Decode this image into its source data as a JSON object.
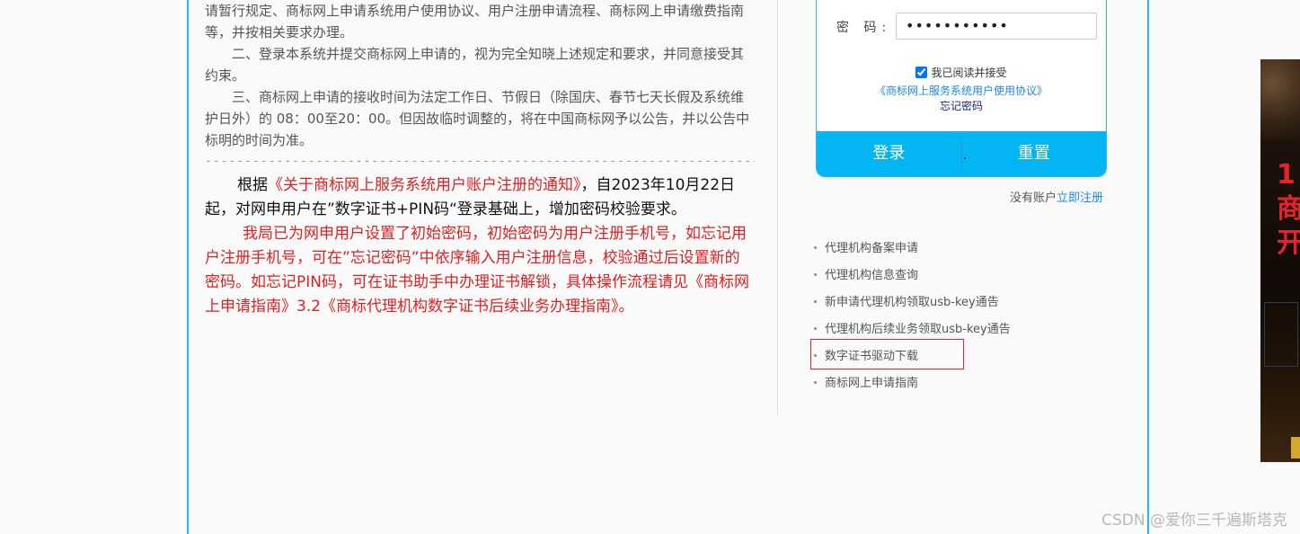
{
  "notice": {
    "p1": "请暂行规定、商标网上申请系统用户使用协议、用户注册申请流程、商标网上申请缴费指南等，并按相关要求办理。",
    "p2": "二、登录本系统并提交商标网上申请的，视为完全知晓上述规定和要求，并同意接受其约束。",
    "p3": "三、商标网上申请的接收时间为法定工作日、节假日（除国庆、春节七天长假及系统维护日外）的 08：00至20：00。但因故临时调整的，将在中国商标网予以公告，并以公告中标明的时间为准。",
    "dashes": "---------------------------------------------------------------------------------",
    "p4_prefix": "根据",
    "p4_link": "《关于商标网上服务系统用户账户注册的通知》",
    "p4_suffix": "，自2023年10月22日起，对网申用户在”数字证书+PIN码“登录基础上，增加密码校验要求。",
    "p5": "我局已为网申用户设置了初始密码，初始密码为用户注册手机号，如忘记用户注册手机号，可在”忘记密码”中依序输入用户注册信息，校验通过后设置新的密码。如忘记PIN码，可在证书助手中办理证书解锁，具体操作流程请见《商标网上申请指南》3.2《商标代理机构数字证书后续业务办理指南》。"
  },
  "login": {
    "password_label": "密 码:",
    "password_value": "•••••••••••",
    "agree_label": "我已阅读并接受",
    "agreement_link": "《商标网上服务系统用户使用协议》",
    "forgot_link": "忘记密码",
    "login_button": "登录",
    "reset_button": "重置",
    "button_separator_mark": ".",
    "no_account_text": "没有账户",
    "register_link": "立即注册"
  },
  "links": [
    "代理机构备案申请",
    "代理机构信息查询",
    "新申请代理机构领取usb-key通告",
    "代理机构后续业务领取usb-key通告",
    "数字证书驱动下载",
    "商标网上申请指南"
  ],
  "side_banner": {
    "text": "1商开"
  },
  "watermark": "CSDN @爱你三千遍斯塔克",
  "colors": {
    "accent": "#03b5f2",
    "notice_red": "#e02020",
    "highlight": "#e0283a"
  }
}
